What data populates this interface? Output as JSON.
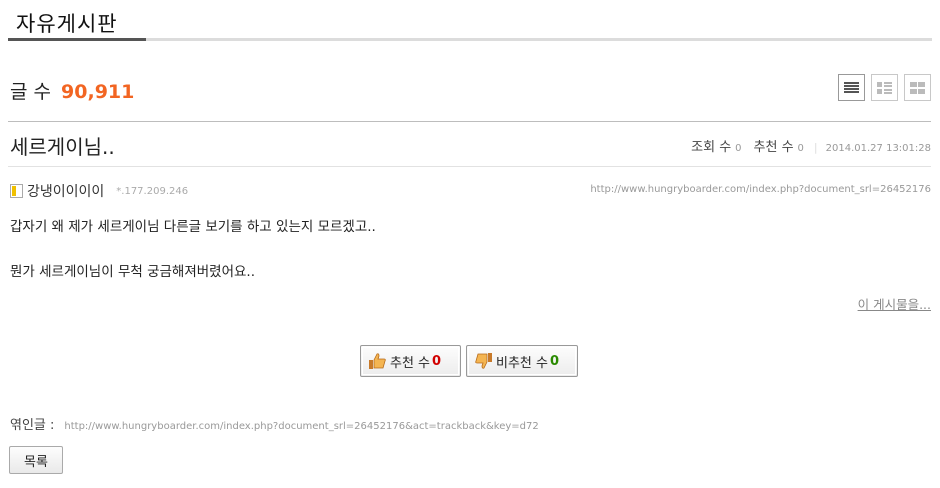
{
  "board": {
    "title": "자유게시판"
  },
  "count": {
    "label": "글 수",
    "value": "90,911"
  },
  "view_modes": [
    {
      "name": "list-view-icon",
      "active": true
    },
    {
      "name": "webzine-view-icon",
      "active": false
    },
    {
      "name": "gallery-view-icon",
      "active": false
    }
  ],
  "post": {
    "title": "세르게이님..",
    "views_label": "조회 수",
    "views_value": "0",
    "recommend_label": "추천 수",
    "recommend_value": "0",
    "separator": "|",
    "date": "2014.01.27 13:01:28",
    "author": "강냉이이이이",
    "ip": "*.177.209.246",
    "url": "http://www.hungryboarder.com/index.php?document_srl=26452176",
    "content": [
      "갑자기 왜 제가 세르게이님 다른글 보기를 하고 있는지 모르겠고..",
      "뭔가 세르게이님이 무척 궁금해져버렸어요.."
    ],
    "author_posts_link": "이 게시물을..."
  },
  "votes": {
    "up_label": "추천 수",
    "up_count": "0",
    "down_label": "비추천 수",
    "down_count": "0"
  },
  "trackback": {
    "label": "엮인글 :",
    "url": "http://www.hungryboarder.com/index.php?document_srl=26452176&act=trackback&key=d72"
  },
  "buttons": {
    "list_label": "목록"
  }
}
